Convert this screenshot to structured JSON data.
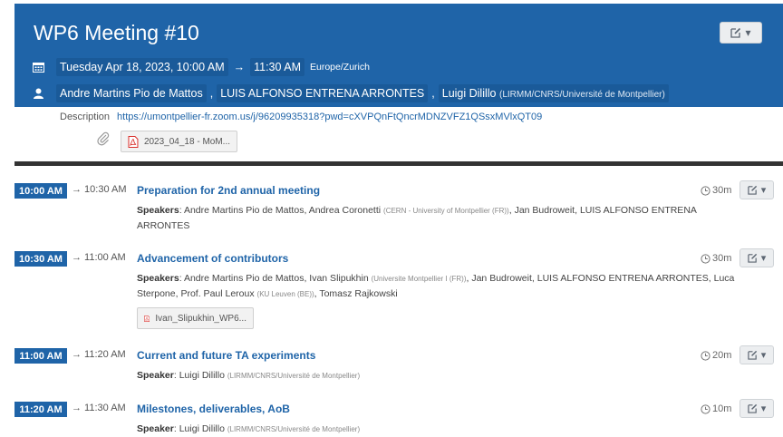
{
  "event": {
    "title": "WP6 Meeting #10",
    "date_start": "Tuesday Apr 18, 2023, 10:00 AM",
    "time_end": "11:30 AM",
    "timezone": "Europe/Zurich",
    "chairs": [
      {
        "name": "Andre Martins Pio de Mattos",
        "affiliation": ""
      },
      {
        "name": "LUIS ALFONSO ENTRENA ARRONTES",
        "affiliation": ""
      },
      {
        "name": "Luigi Dilillo",
        "affiliation": "(LIRMM/CNRS/Université de Montpellier)"
      }
    ],
    "description_label": "Description",
    "description_link": "https://umontpellier-fr.zoom.us/j/96209935318?pwd=cXVPQnFtQncrMDNZVFZ1QSsxMVlxQT09",
    "attachment": "2023_04_18 - MoM...",
    "separator": ","
  },
  "icons": {
    "calendar": "calendar-icon",
    "user": "user-icon",
    "paperclip": "paperclip-icon",
    "pdf": "pdf-icon",
    "clock": "clock-icon",
    "edit": "edit-icon",
    "caret": "caret-down-icon"
  },
  "ui": {
    "arrow": "→",
    "caret": "▾",
    "speakers_label": "Speakers",
    "speaker_label": "Speaker"
  },
  "colors": {
    "brand": "#1f64a8",
    "divider": "#333333"
  },
  "entries": [
    {
      "start": "10:00 AM",
      "end": "→ 10:30 AM",
      "title": "Preparation for 2nd annual meeting",
      "duration": "30m",
      "speakers_label": "Speakers",
      "speakers": [
        {
          "name": "Andre Martins Pio de Mattos",
          "aff": ""
        },
        {
          "name": "Andrea Coronetti",
          "aff": "(CERN - University of Montpellier (FR))"
        },
        {
          "name": "Jan Budroweit",
          "aff": ""
        },
        {
          "name": "LUIS ALFONSO ENTRENA ARRONTES",
          "aff": ""
        }
      ],
      "attachment": ""
    },
    {
      "start": "10:30 AM",
      "end": "→ 11:00 AM",
      "title": "Advancement of contributors",
      "duration": "30m",
      "speakers_label": "Speakers",
      "speakers": [
        {
          "name": "Andre Martins Pio de Mattos",
          "aff": ""
        },
        {
          "name": "Ivan Slipukhin",
          "aff": "(Universite Montpellier I (FR))"
        },
        {
          "name": "Jan Budroweit",
          "aff": ""
        },
        {
          "name": "LUIS ALFONSO ENTRENA ARRONTES",
          "aff": ""
        },
        {
          "name": "Luca Sterpone",
          "aff": ""
        },
        {
          "name": "Prof. Paul Leroux",
          "aff": "(KU Leuven (BE))"
        },
        {
          "name": "Tomasz Rajkowski",
          "aff": ""
        }
      ],
      "attachment": "Ivan_Slipukhin_WP6..."
    },
    {
      "start": "11:00 AM",
      "end": "→ 11:20 AM",
      "title": "Current and future TA experiments",
      "duration": "20m",
      "speakers_label": "Speaker",
      "speakers": [
        {
          "name": "Luigi Dilillo",
          "aff": "(LIRMM/CNRS/Université de Montpellier)"
        }
      ],
      "attachment": ""
    },
    {
      "start": "11:20 AM",
      "end": "→ 11:30 AM",
      "title": "Milestones, deliverables, AoB",
      "duration": "10m",
      "speakers_label": "Speaker",
      "speakers": [
        {
          "name": "Luigi Dilillo",
          "aff": "(LIRMM/CNRS/Université de Montpellier)"
        }
      ],
      "attachment": ""
    }
  ]
}
